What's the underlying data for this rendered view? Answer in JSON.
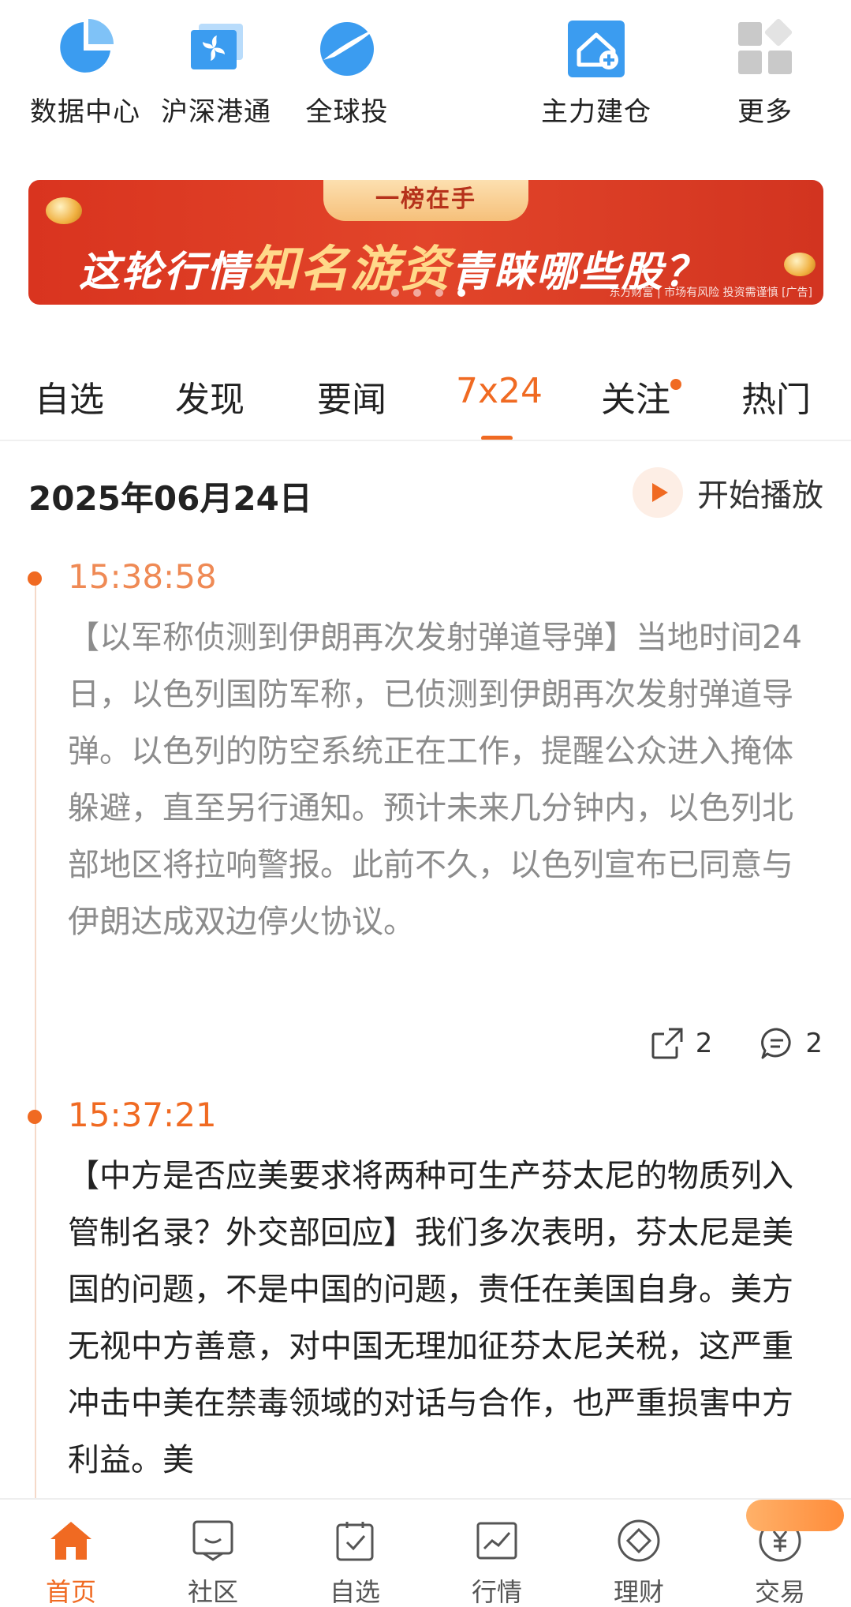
{
  "quick_access": [
    {
      "label": "数据中心",
      "icon": "pie-chart-icon"
    },
    {
      "label": "沪深港通",
      "icon": "hk-bauhinia-icon"
    },
    {
      "label": "全球投",
      "icon": "globe-plane-icon"
    },
    {
      "label": "主力建仓",
      "icon": "house-plus-icon"
    },
    {
      "label": "更多",
      "icon": "grid-more-icon"
    }
  ],
  "banner": {
    "tag": "一榜在手",
    "text_pre": "这轮行情",
    "text_highlight": "知名游资",
    "text_post": "青睐哪些股？",
    "brand": "东方财富 | 市场有风险 投资需谨慎 [广告]",
    "slide_count": 4,
    "active_slide": 4
  },
  "tabs": [
    {
      "label": "自选"
    },
    {
      "label": "发现"
    },
    {
      "label": "要闻"
    },
    {
      "label": "7x24",
      "active": true
    },
    {
      "label": "关注",
      "has_dot": true
    },
    {
      "label": "热门"
    }
  ],
  "date": "2025年06月24日",
  "play_label": "开始播放",
  "news": [
    {
      "time": "15:38:58",
      "text": "【以军称侦测到伊朗再次发射弹道导弹】当地时间24日，以色列国防军称，已侦测到伊朗再次发射弹道导弹。以色列的防空系统正在工作，提醒公众进入掩体躲避，直至另行通知。预计未来几分钟内，以色列北部地区将拉响警报。此前不久，以色列宣布已同意与伊朗达成双边停火协议。",
      "read": true,
      "share_count": "2",
      "comment_count": "2"
    },
    {
      "time": "15:37:21",
      "text": "【中方是否应美要求将两种可生产芬太尼的物质列入管制名录？外交部回应】我们多次表明，芬太尼是美国的问题，不是中国的问题，责任在美国自身。美方无视中方善意，对中国无理加征芬太尼关税，这严重冲击中美在禁毒领域的对话与合作，也严重损害中方利益。美",
      "read": false
    }
  ],
  "bottom_nav": [
    {
      "label": "首页",
      "icon": "home-icon",
      "active": true
    },
    {
      "label": "社区",
      "icon": "community-icon"
    },
    {
      "label": "自选",
      "icon": "watchlist-icon"
    },
    {
      "label": "行情",
      "icon": "market-chart-icon"
    },
    {
      "label": "理财",
      "icon": "wealth-diamond-icon"
    },
    {
      "label": "交易",
      "icon": "trade-yuan-icon"
    }
  ],
  "colors": {
    "accent": "#f06a22",
    "icon_blue": "#3b9cf0",
    "banner_red": "#d9341f"
  }
}
